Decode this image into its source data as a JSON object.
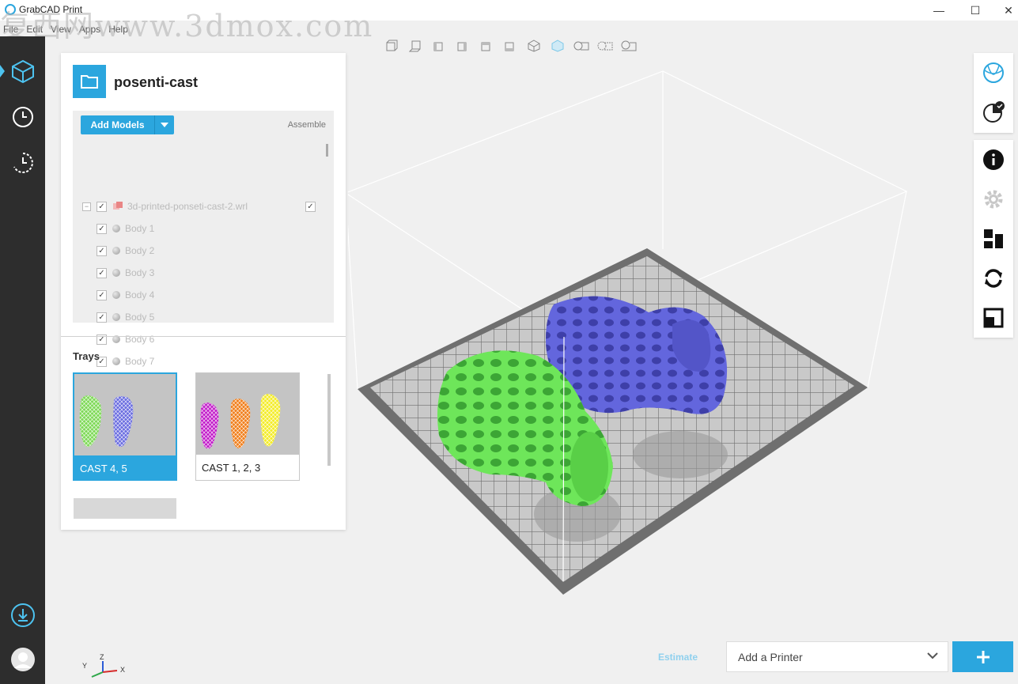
{
  "window": {
    "title": "GrabCAD Print",
    "min_icon": "—",
    "max_icon": "☐",
    "close_icon": "✕"
  },
  "watermark": "复西网www.3dmox.com",
  "menu": [
    "File",
    "Edit",
    "View",
    "Apps",
    "Help"
  ],
  "rail": {
    "items": [
      {
        "name": "cube-icon",
        "active": true
      },
      {
        "name": "clock-icon",
        "active": false
      },
      {
        "name": "history-icon",
        "active": false
      }
    ],
    "bottom": [
      {
        "name": "download-icon"
      },
      {
        "name": "avatar"
      }
    ]
  },
  "project": {
    "name": "posenti-cast",
    "add_models_label": "Add Models",
    "assemble_label": "Assemble",
    "file": "3d-printed-ponseti-cast-2.wrl",
    "bodies": [
      "Body 1",
      "Body 2",
      "Body 3",
      "Body 4",
      "Body 5",
      "Body 6",
      "Body 7"
    ]
  },
  "trays": {
    "label": "Trays",
    "items": [
      {
        "caption": "CAST 4, 5",
        "selected": true,
        "colors": [
          "#7ed957",
          "#6b6ee0"
        ]
      },
      {
        "caption": "CAST 1, 2, 3",
        "selected": false,
        "colors": [
          "#c21dc9",
          "#f07f1c",
          "#f3ec2a"
        ]
      }
    ]
  },
  "colors": {
    "accent": "#2ba6de",
    "rail": "#2d2d2d",
    "green_model": "#6ee65a",
    "blue_model": "#6366dd",
    "bed": "#6f6f6f"
  },
  "bottom": {
    "estimate_label": "Estimate",
    "printer_label": "Add a Printer",
    "add_icon": "+"
  },
  "axes": {
    "y": "Y",
    "z": "Z",
    "x": "X"
  }
}
